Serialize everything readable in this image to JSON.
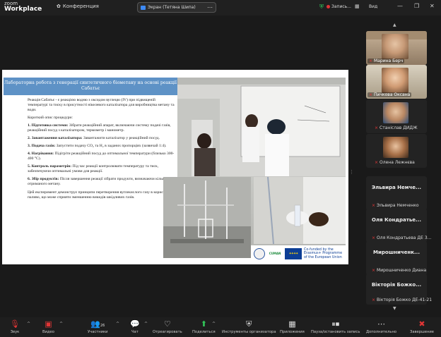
{
  "app": {
    "logo_top": "zoom",
    "logo_bottom": "Workplace",
    "conference_label": "Конференция",
    "screen_share_label": "Экран (Тетяна Шипа)",
    "recording_label": "Запись...",
    "view_label": "Вид"
  },
  "slide": {
    "title": "Лабораторна робота з генерації синтетичного біометану на основі реакції Сабатьє",
    "intro": "Реакція Сабатьє - є реакцією водню з оксидом вуглецю (IV) при підвищеній температурі та тиску в присутності нікелевого каталізатора для виробництва метану та води.",
    "short_desc": "Короткий опис процедури:",
    "steps": [
      {
        "head": "1. Підготовка системи:",
        "body": " Зібрати реакційний апарат, включаючи систему подачі газів, реакційний посуд з каталізатором, термометр і манометр."
      },
      {
        "head": "2. Завантаження каталізатора:",
        "body": " Завантажити каталізатор у реакційний посуд."
      },
      {
        "head": "3. Подача газів:",
        "body": " Запустити подачу CO₂ та H₂ в заданих пропорціях (зазвичай 1:4)."
      },
      {
        "head": "4. Нагрівання:",
        "body": " Підігріти реакційний посуд до оптимальної температури (близько 300-400 °C)."
      },
      {
        "head": "5. Контроль параметрів:",
        "body": " Під час реакції контролювати температуру та тиск, забезпечуючи оптимальні умови для реакції."
      },
      {
        "head": "6. Збір продуктів:",
        "body": " Після завершення реакції зібрати продукти, визначаючи кількість отриманого метану."
      }
    ],
    "conclusion": "Цей експеримент демонструє принципи перетворення вуглекислого газу в корисне паливо, що може сприяти зменшенню викидів шкідливих газів.",
    "cuman_label": "CUMAN",
    "eu_text": [
      "Co-funded by the",
      "Erasmus+ Programme",
      "of the European Union"
    ]
  },
  "participants": [
    {
      "name": "Марина Берч",
      "type": "video"
    },
    {
      "name": "Пичкова Оксана",
      "type": "video"
    },
    {
      "name": "Станіслав ДИДЖ",
      "type": "video"
    },
    {
      "name": "Олена Лежнєва",
      "type": "video"
    },
    {
      "big": "Эльвира Немче...",
      "name": "Эльвира Немченко",
      "type": "name"
    },
    {
      "big": "Оля Кондратье...",
      "name": "Оля Кондратьева ДЕ 3...",
      "type": "name"
    },
    {
      "big": "Мирошниченк...",
      "name": "Мирошниченко Диана",
      "type": "name"
    },
    {
      "big": "Вікторія Божко...",
      "name": "Вікторія Божко ДЕ-41-21",
      "type": "name"
    }
  ],
  "toolbar": {
    "mic": "Звук",
    "video": "Видео",
    "participants": "Участники",
    "participants_count": "26",
    "chat": "Чат",
    "react": "Отреагировать",
    "share": "Поделиться",
    "host_tools": "Инструменты организатора",
    "apps": "Приложения",
    "pause_rec": "Пауза/остановить запись",
    "more": "Дополнительно",
    "end": "Завершение"
  },
  "colors": {
    "slide_title_bg": "#5e92c6",
    "mic_off": "#e03535",
    "share_green": "#32c85a",
    "background": "#1a1a1a"
  }
}
